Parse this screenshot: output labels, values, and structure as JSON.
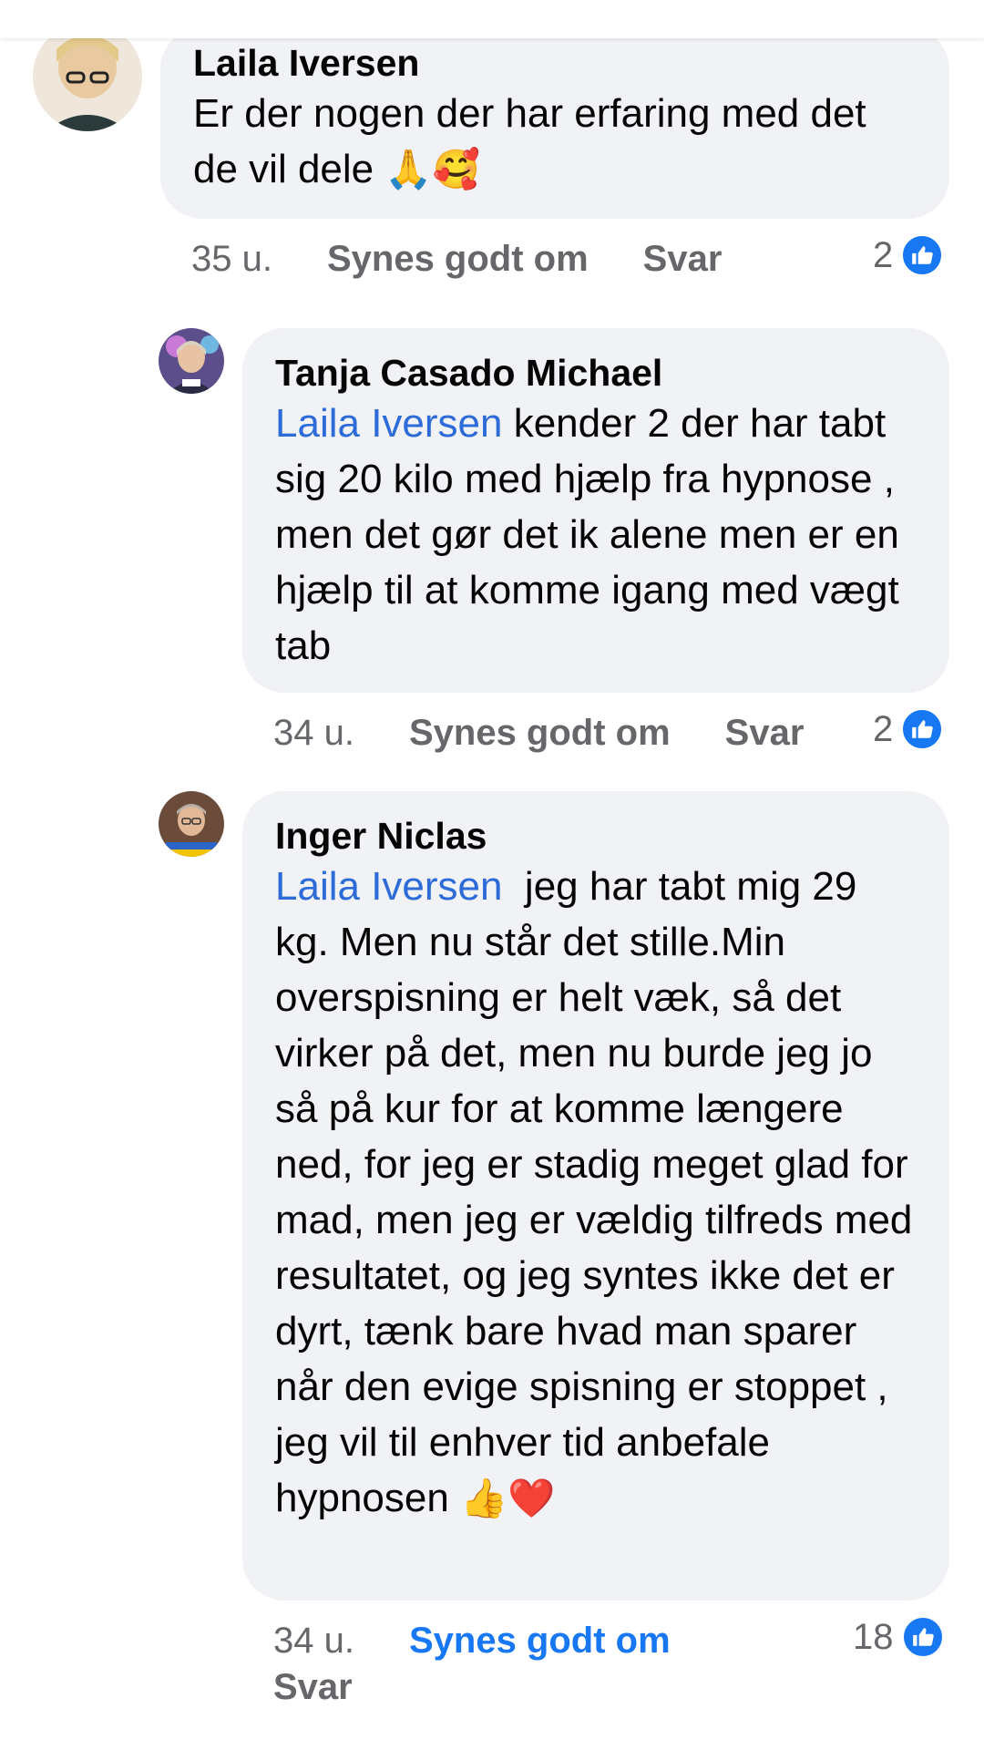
{
  "comments": [
    {
      "author": "Laila Iversen",
      "text": "Er der nogen der har erfaring med det de vil dele",
      "emoji": "🙏🥰",
      "time": "35 u.",
      "like_label": "Synes godt om",
      "reply_label": "Svar",
      "reaction_count": "2"
    },
    {
      "author": "Tanja Casado Michael",
      "mention": "Laila Iversen",
      "text": " kender 2 der har tabt sig 20 kilo med hjælp fra hypnose , men det gør det ik alene men er en hjælp til at komme igang med vægt tab",
      "time": "34 u.",
      "like_label": "Synes godt om",
      "reply_label": "Svar",
      "reaction_count": "2"
    },
    {
      "author": "Inger Niclas",
      "mention": "Laila Iversen",
      "text": "  jeg har tabt mig 29 kg. Men nu står det stille.Min overspisning er helt væk, så det virker på det, men nu burde jeg jo så på kur for at komme længere ned, for jeg er stadig meget glad for mad, men jeg er vældig tilfreds med resultatet, og jeg syntes ikke det er dyrt, tænk bare hvad man sparer når den evige spisning er stoppet , jeg vil til enhver tid anbefale hypnosen",
      "emoji": "👍❤️",
      "time": "34 u.",
      "like_label": "Synes godt om",
      "reply_label": "Svar",
      "reaction_count": "18"
    }
  ],
  "colors": {
    "bubble": "#f0f2f5",
    "mention": "#2d6bd8",
    "like_blue": "#1877f2",
    "meta_gray": "#65676b"
  }
}
